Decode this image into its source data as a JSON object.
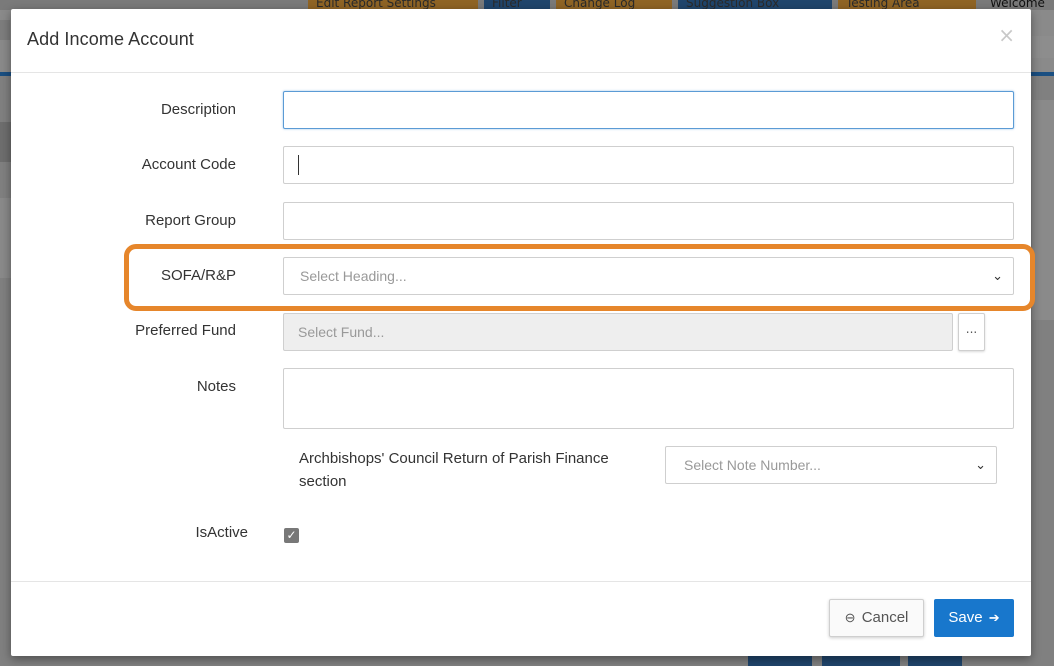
{
  "background": {
    "top_buttons": [
      "Edit Report Settings",
      "Filter",
      "Change Log",
      "Suggestion Box",
      "Testing Area",
      "Welcome"
    ]
  },
  "modal": {
    "title": "Add Income Account",
    "close_label": "×",
    "fields": {
      "description": {
        "label": "Description",
        "value": ""
      },
      "account_code": {
        "label": "Account Code",
        "value": ""
      },
      "report_group": {
        "label": "Report Group",
        "value": ""
      },
      "sofa": {
        "label": "SOFA/R&P",
        "placeholder": "Select Heading..."
      },
      "preferred_fund": {
        "label": "Preferred Fund",
        "placeholder": "Select Fund...",
        "button_label": "..."
      },
      "notes": {
        "label": "Notes",
        "value": ""
      },
      "arch_section": {
        "label": "Archbishops' Council Return of Parish Finance section",
        "placeholder": "Select Note Number..."
      },
      "is_active": {
        "label": "IsActive",
        "checked": true,
        "check_glyph": "✓"
      }
    },
    "footer": {
      "cancel_label": "Cancel",
      "save_label": "Save"
    }
  },
  "colors": {
    "highlight": "#e6862b",
    "save_button": "#1877cc",
    "focus_border": "#5b9bd5"
  }
}
